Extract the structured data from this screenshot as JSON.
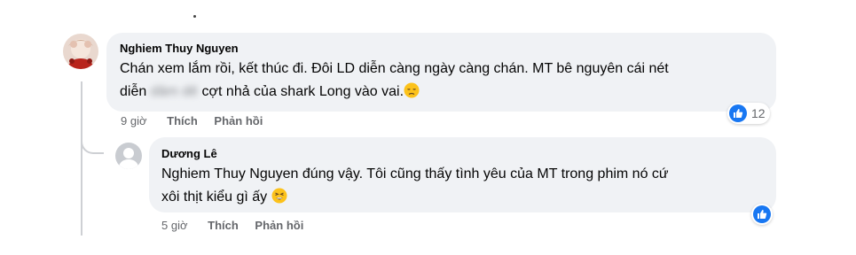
{
  "comment1": {
    "author": "Nghiem Thuy Nguyen",
    "line1": "Chán xem lắm rồi, kết thúc đi. Đôi LD diễn càng ngày càng chán. MT bê nguyên cái nét",
    "line2_before": "diễn",
    "line2_blurred": "dâm dê",
    "line2_after": "cợt nhả của shark Long vào vai.",
    "emoji": "disappointed-face-icon",
    "time": "9 giờ",
    "like_label": "Thích",
    "reply_label": "Phản hồi",
    "reaction_count": "12"
  },
  "reply1": {
    "author": "Dương Lê",
    "mention": "Nghiem Thuy Nguyen",
    "line1_after": "đúng vậy. Tôi cũng thấy tình yêu của MT trong phim nó cứ",
    "line2": "xôi thịt kiểu gì ấy",
    "emoji": "tired-face-icon",
    "time": "5 giờ",
    "like_label": "Thích",
    "reply_label": "Phản hồi"
  },
  "colors": {
    "bubble": "#f0f2f5",
    "meta_text": "#65676b",
    "like_blue": "#1877f2",
    "thread_line": "#ced0d4"
  }
}
